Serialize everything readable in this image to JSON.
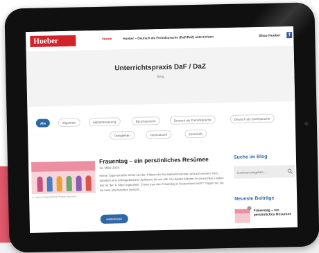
{
  "nav": {
    "logo": "Hueber",
    "links": [
      {
        "label": "Home",
        "active": true
      },
      {
        "label": "Hueber – Deutsch als Fremdsprache (DaF/DaZ) unterrichten",
        "active": false
      },
      {
        "label": "Shop Hueber",
        "active": false
      }
    ],
    "facebook_icon": "f"
  },
  "hero": {
    "title": "Unterrichtspraxis DaF / DaZ",
    "subtitle": "Blog"
  },
  "categories": [
    {
      "label": "Alle",
      "active": true
    },
    {
      "label": "Allgemein"
    },
    {
      "label": "Alphabetisierung"
    },
    {
      "label": "Berufssprache"
    },
    {
      "label": "Deutsch als Fremdsprache"
    },
    {
      "label": "Deutsch als Zweitsprache"
    },
    {
      "label": "Fertigkeiten"
    },
    {
      "label": "Interkulturell"
    },
    {
      "label": "Zeitschrift"
    }
  ],
  "post": {
    "title": "Frauentag – ein persönliches Resümee",
    "date": "12. März 2019",
    "excerpt": "Kleine Tulpensträuße stehen an den Plätzen der Kursteilnehmerinnen und auf meinem Tisch, daneben eine selbstgebackene Apfeltorte für uns alle. Die beiden Männer im Deutschkurs haben das für den 8. März organisiert. „Feiert man den Frauentag in Deutschland nicht?“ fragen sie, als sie mein überraschtes Gesicht…",
    "image_caption": "© Lorem Images/Stock Photos Ipsumino",
    "read_more": "weiterlesen"
  },
  "sidebar": {
    "search_heading": "Suche im Blog",
    "search_placeholder": "Suchwort eingeben …",
    "recent_heading": "Neueste Beiträge",
    "recent_title": "Frauentag – ein persönliches Resümee"
  },
  "colors": {
    "brand": "#d2232a",
    "accent": "#2f67a5",
    "pink": "#e1576b"
  }
}
